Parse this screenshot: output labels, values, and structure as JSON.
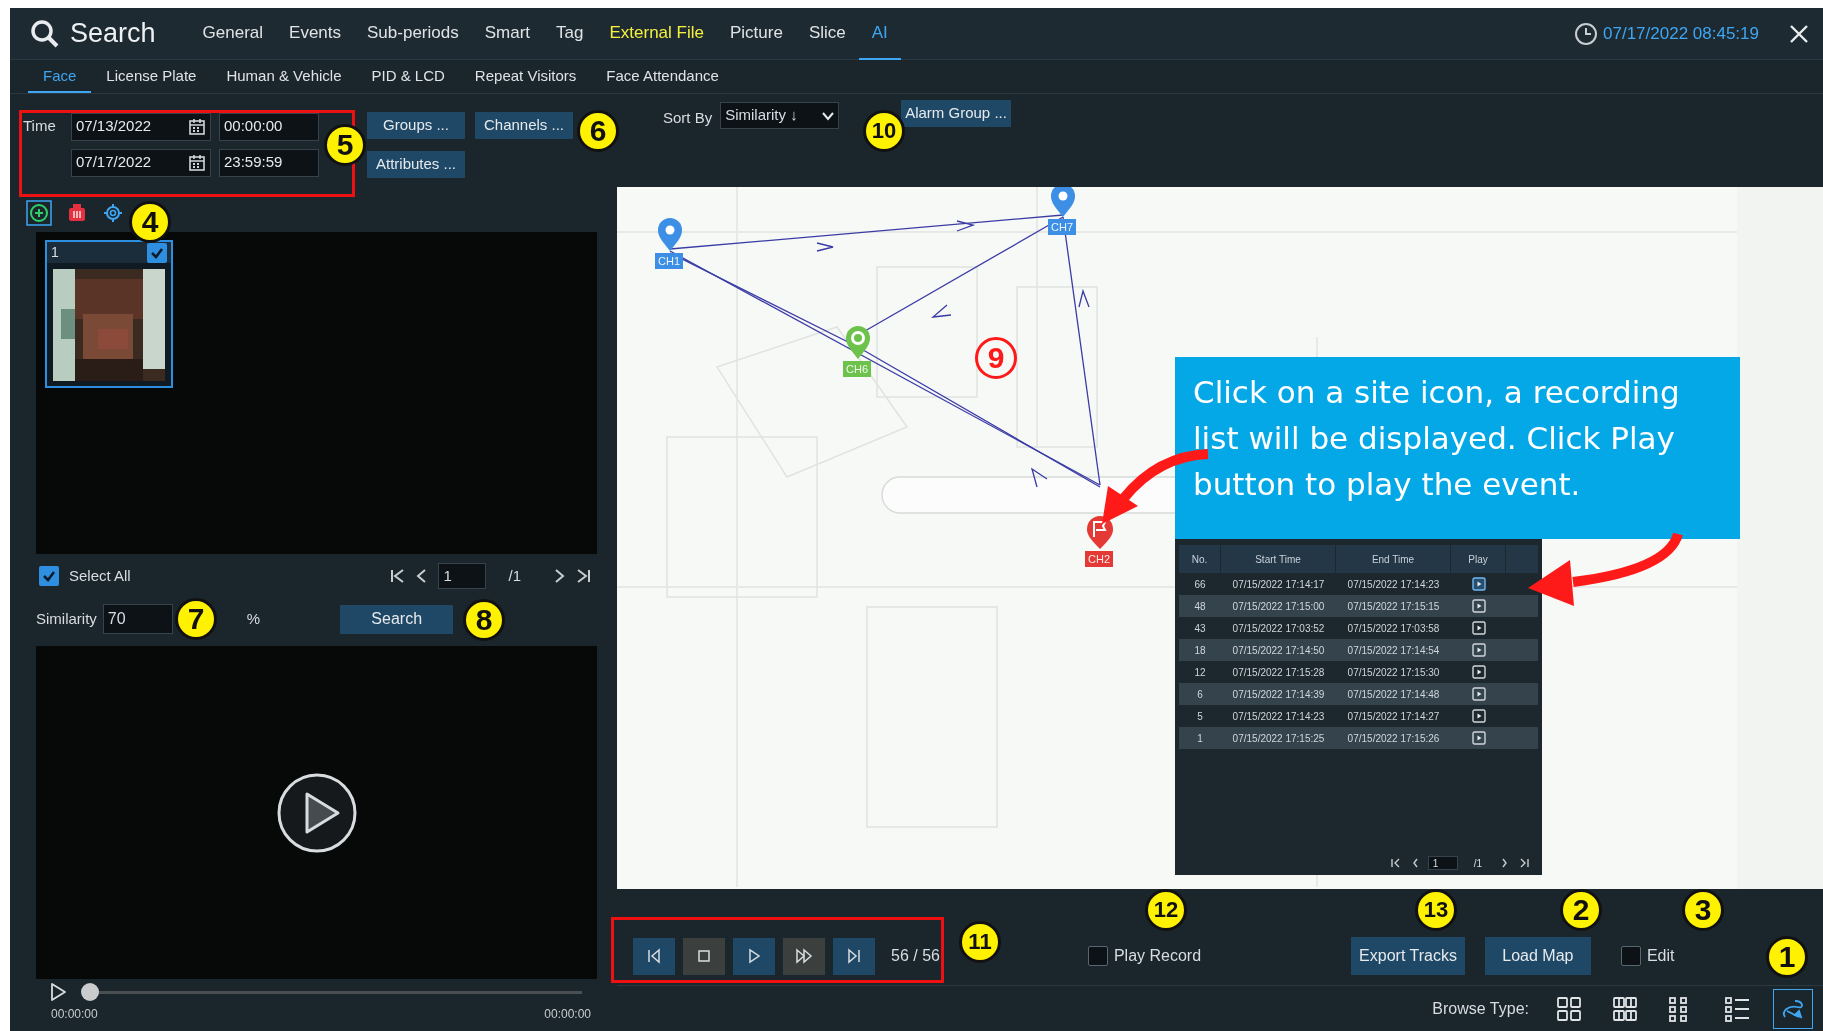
{
  "header": {
    "title": "Search",
    "tabs": [
      {
        "label": "General",
        "selected": false,
        "highlighted": false
      },
      {
        "label": "Events",
        "selected": false,
        "highlighted": false
      },
      {
        "label": "Sub-periods",
        "selected": false,
        "highlighted": false
      },
      {
        "label": "Smart",
        "selected": false,
        "highlighted": false
      },
      {
        "label": "Tag",
        "selected": false,
        "highlighted": false
      },
      {
        "label": "External File",
        "selected": false,
        "highlighted": true
      },
      {
        "label": "Picture",
        "selected": false,
        "highlighted": false
      },
      {
        "label": "Slice",
        "selected": false,
        "highlighted": false
      },
      {
        "label": "AI",
        "selected": true,
        "highlighted": false
      }
    ],
    "datetime": "07/17/2022 08:45:19"
  },
  "subtabs": [
    {
      "label": "Face",
      "selected": true
    },
    {
      "label": "License Plate",
      "selected": false
    },
    {
      "label": "Human & Vehicle",
      "selected": false
    },
    {
      "label": "PID & LCD",
      "selected": false
    },
    {
      "label": "Repeat Visitors",
      "selected": false
    },
    {
      "label": "Face Attendance",
      "selected": false
    }
  ],
  "filters": {
    "time_label": "Time",
    "start_date": "07/13/2022",
    "start_time": "00:00:00",
    "end_date": "07/17/2022",
    "end_time": "23:59:59",
    "buttons": [
      "Groups ...",
      "Channels ...",
      "Attributes ..."
    ],
    "sort_label": "Sort By",
    "sort_value": "Similarity ↓",
    "alarm_group": "Alarm Group ..."
  },
  "faces": [
    {
      "label": "1",
      "checked": true
    }
  ],
  "select_all": {
    "label": "Select All",
    "checked": true
  },
  "pager": {
    "page": "1",
    "total": "/1"
  },
  "similarity": {
    "label": "Similarity",
    "value": "70",
    "unit": "%"
  },
  "search_button": "Search",
  "player": {
    "level": 0,
    "start": "00:00:00",
    "end": "00:00:00"
  },
  "map": {
    "pins": [
      {
        "label": "CH1",
        "kind": "marker",
        "color": "#3d8fe6"
      },
      {
        "label": "CH7",
        "kind": "marker",
        "color": "#3d8fe6"
      },
      {
        "label": "CH6",
        "kind": "target",
        "color": "#6cc24a"
      },
      {
        "label": "CH2",
        "kind": "flag",
        "color": "#e53935"
      }
    ]
  },
  "callout": "Click on a site icon, a recording list will be displayed. Click Play button to play the event.",
  "records": {
    "columns": [
      "No.",
      "Start Time",
      "End Time",
      "Play"
    ],
    "rows": [
      {
        "no": "66",
        "start": "07/15/2022 17:14:17",
        "end": "07/15/2022 17:14:23",
        "selected": true
      },
      {
        "no": "48",
        "start": "07/15/2022 17:15:00",
        "end": "07/15/2022 17:15:15",
        "selected": false
      },
      {
        "no": "43",
        "start": "07/15/2022 17:03:52",
        "end": "07/15/2022 17:03:58",
        "selected": false
      },
      {
        "no": "18",
        "start": "07/15/2022 17:14:50",
        "end": "07/15/2022 17:14:54",
        "selected": false
      },
      {
        "no": "12",
        "start": "07/15/2022 17:15:28",
        "end": "07/15/2022 17:15:30",
        "selected": false
      },
      {
        "no": "6",
        "start": "07/15/2022 17:14:39",
        "end": "07/15/2022 17:14:48",
        "selected": false
      },
      {
        "no": "5",
        "start": "07/15/2022 17:14:23",
        "end": "07/15/2022 17:14:27",
        "selected": false
      },
      {
        "no": "1",
        "start": "07/15/2022 17:15:25",
        "end": "07/15/2022 17:15:26",
        "selected": false
      }
    ],
    "pager": {
      "page": "1",
      "total": "/1"
    }
  },
  "playback": {
    "counter": "56 / 56"
  },
  "play_record": {
    "label": "Play Record",
    "checked": false
  },
  "buttons": [
    "Export Tracks",
    "Load Map"
  ],
  "edit": {
    "label": "Edit",
    "checked": false
  },
  "browse": {
    "label": "Browse Type:",
    "modes": [
      {
        "kind": "grid",
        "selected": false
      },
      {
        "kind": "split",
        "selected": false
      },
      {
        "kind": "dots",
        "selected": false
      },
      {
        "kind": "list",
        "selected": false
      },
      {
        "kind": "track",
        "selected": true
      }
    ]
  },
  "annotations": [
    {
      "label": "5",
      "kind": "badge"
    },
    {
      "label": "6",
      "kind": "badge"
    },
    {
      "label": "10",
      "kind": "badge"
    },
    {
      "label": "4",
      "kind": "badge"
    },
    {
      "label": "9",
      "kind": "ring"
    },
    {
      "label": "7",
      "kind": "badge"
    },
    {
      "label": "8",
      "kind": "badge"
    },
    {
      "label": "11",
      "kind": "badge"
    },
    {
      "label": "12",
      "kind": "badge"
    },
    {
      "label": "13",
      "kind": "badge"
    },
    {
      "label": "2",
      "kind": "badge"
    },
    {
      "label": "3",
      "kind": "badge"
    },
    {
      "label": "1",
      "kind": "badge"
    }
  ]
}
